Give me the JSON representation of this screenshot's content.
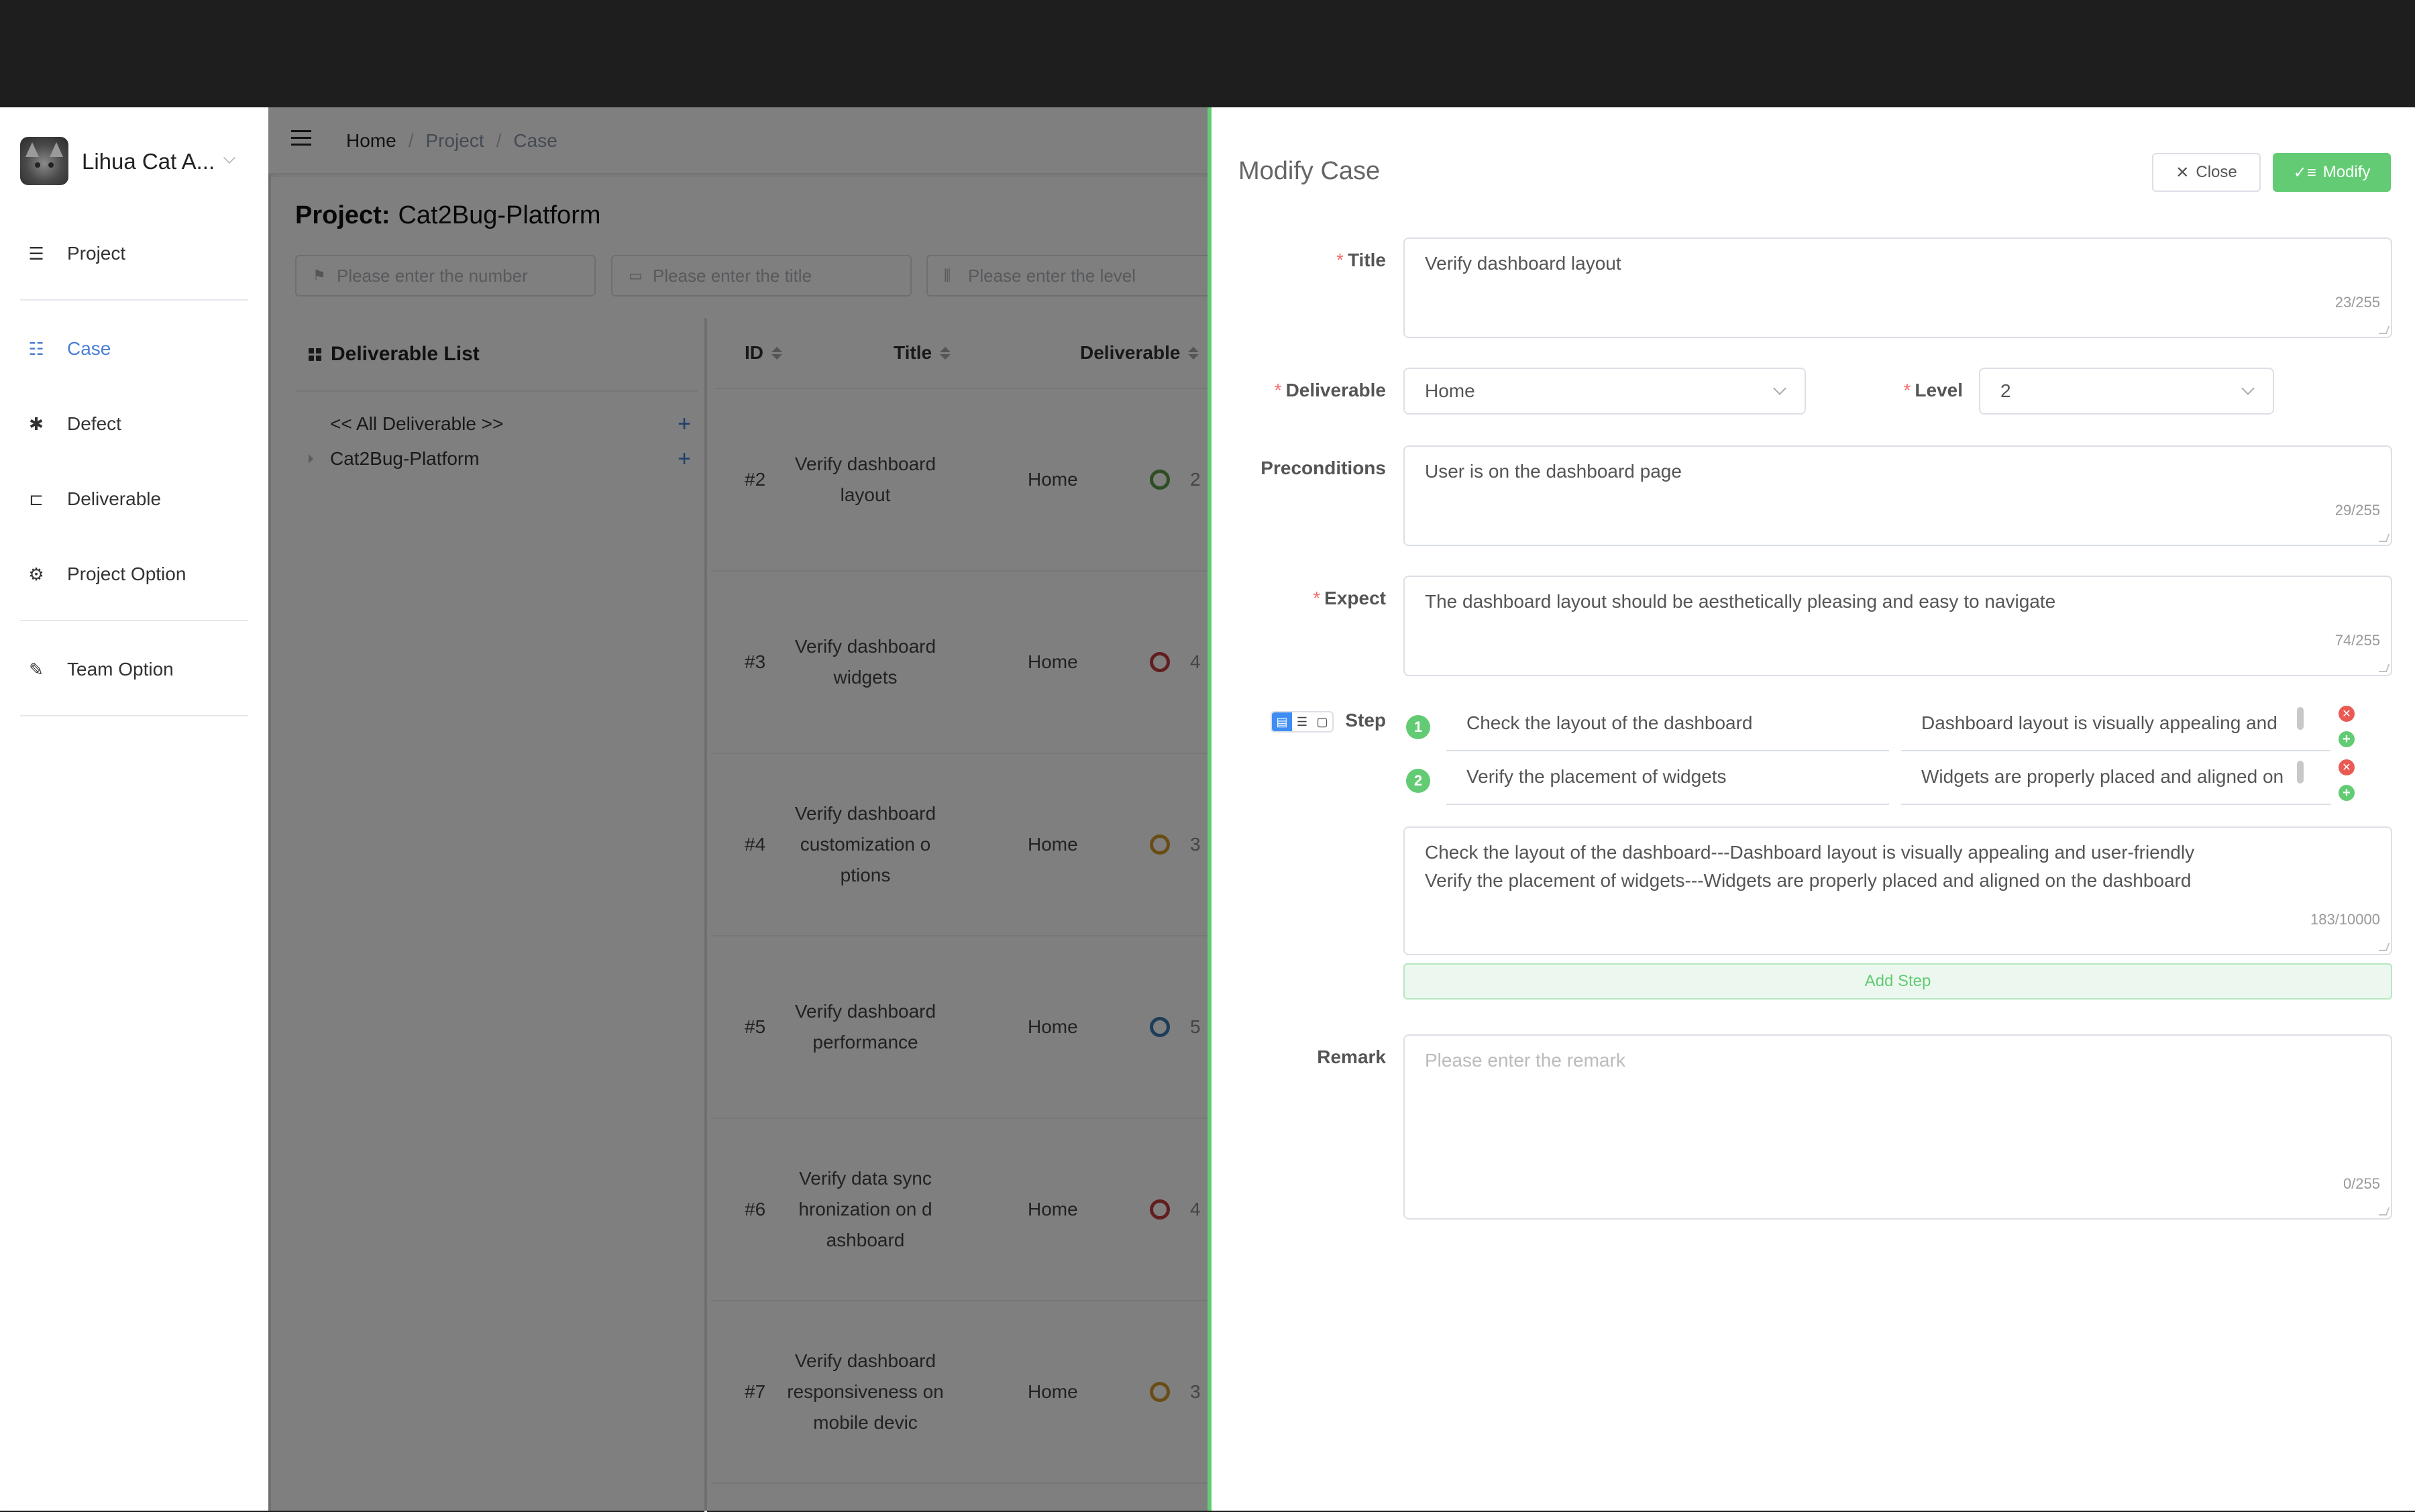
{
  "sidebar": {
    "team_name": "Lihua Cat A...",
    "items": [
      {
        "label": "Project",
        "icon": "list-icon"
      },
      {
        "label": "Case",
        "icon": "case-list-icon",
        "active": true
      },
      {
        "label": "Defect",
        "icon": "bug-icon"
      },
      {
        "label": "Deliverable",
        "icon": "tree-icon"
      },
      {
        "label": "Project Option",
        "icon": "gear-icon"
      },
      {
        "label": "Team Option",
        "icon": "document-edit-icon"
      }
    ]
  },
  "breadcrumb": [
    "Home",
    "Project",
    "Case"
  ],
  "project": {
    "label": "Project:",
    "name": "Cat2Bug-Platform"
  },
  "filters": {
    "number_placeholder": "Please enter the number",
    "title_placeholder": "Please enter the title",
    "level_placeholder": "Please enter the level"
  },
  "deliverable_panel": {
    "title": "Deliverable List",
    "items": [
      "<< All Deliverable >>",
      "Cat2Bug-Platform"
    ]
  },
  "table": {
    "columns": [
      "ID",
      "Title",
      "Deliverable"
    ],
    "rows": [
      {
        "id": "#2",
        "title": "Verify dashboard layout",
        "deliverable": "Home",
        "level": "2",
        "level_color": "#5d9b47"
      },
      {
        "id": "#3",
        "title": "Verify dashboard widgets",
        "deliverable": "Home",
        "level": "4",
        "level_color": "#c23c3c"
      },
      {
        "id": "#4",
        "title": "Verify dashboard customization o ptions",
        "deliverable": "Home",
        "level": "3",
        "level_color": "#d39a2a"
      },
      {
        "id": "#5",
        "title": "Verify dashboard performance",
        "deliverable": "Home",
        "level": "5",
        "level_color": "#3b7bb0"
      },
      {
        "id": "#6",
        "title": "Verify data sync hronization on d ashboard",
        "deliverable": "Home",
        "level": "4",
        "level_color": "#c23c3c"
      },
      {
        "id": "#7",
        "title": "Verify dashboard responsiveness on mobile devic",
        "deliverable": "Home",
        "level": "3",
        "level_color": "#d39a2a"
      }
    ]
  },
  "drawer": {
    "title": "Modify Case",
    "close_label": "Close",
    "modify_label": "Modify",
    "accent": "#62cb73",
    "fields": {
      "title": {
        "label": "Title",
        "value": "Verify dashboard layout",
        "count": "23/255"
      },
      "deliverable": {
        "label": "Deliverable",
        "value": "Home"
      },
      "level": {
        "label": "Level",
        "value": "2"
      },
      "preconditions": {
        "label": "Preconditions",
        "value": "User is on the dashboard page",
        "count": "29/255"
      },
      "expect": {
        "label": "Expect",
        "value": "The dashboard layout should be aesthetically pleasing and easy to navigate",
        "count": "74/255"
      },
      "step": {
        "label": "Step",
        "steps": [
          {
            "num": "1",
            "action": "Check the layout of the dashboard",
            "result": "Dashboard layout is visually appealing and"
          },
          {
            "num": "2",
            "action": "Verify the placement of widgets",
            "result": "Widgets are properly placed and aligned on"
          }
        ],
        "text_line1": "Check the layout of the dashboard---Dashboard layout is visually appealing and user-friendly",
        "text_line2": "Verify the placement of widgets---Widgets are properly placed and aligned on the dashboard",
        "count": "183/10000",
        "add_label": "Add Step"
      },
      "remark": {
        "label": "Remark",
        "placeholder": "Please enter the remark",
        "count": "0/255"
      }
    }
  }
}
